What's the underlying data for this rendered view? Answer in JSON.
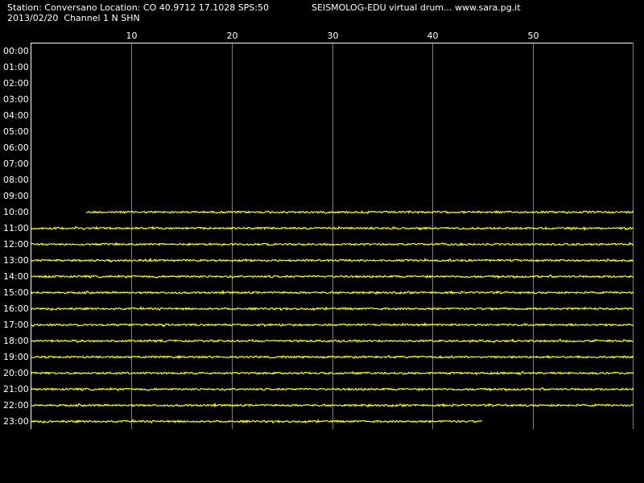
{
  "header": {
    "station_line": "Station: Conversano Location: CO 40.9712 17.1028 SPS:50",
    "title": "SEISMOLOG-EDU virtual drum... www.sara.pg.it",
    "date_line": "2013/02/20  Channel 1 N SHN"
  },
  "colors": {
    "background": "#000000",
    "trace": "#ffff00",
    "grid": "#808080",
    "axis": "#ffffff",
    "text": "#ffffff"
  },
  "chart_data": {
    "type": "line",
    "title": "",
    "xlabel": "",
    "ylabel": "",
    "x_unit": "minutes",
    "xlim": [
      0,
      60
    ],
    "x_ticks": [
      10,
      20,
      30,
      40,
      50
    ],
    "grid": true,
    "rows": [
      "00:00",
      "01:00",
      "02:00",
      "03:00",
      "04:00",
      "05:00",
      "06:00",
      "07:00",
      "08:00",
      "09:00",
      "10:00",
      "11:00",
      "12:00",
      "13:00",
      "14:00",
      "15:00",
      "16:00",
      "17:00",
      "18:00",
      "19:00",
      "20:00",
      "21:00",
      "22:00",
      "23:00"
    ],
    "traces": [
      {
        "row": "10:00",
        "start_min": 5.5,
        "end_min": 60
      },
      {
        "row": "11:00",
        "start_min": 0,
        "end_min": 60
      },
      {
        "row": "12:00",
        "start_min": 0,
        "end_min": 60
      },
      {
        "row": "13:00",
        "start_min": 0,
        "end_min": 60
      },
      {
        "row": "14:00",
        "start_min": 0,
        "end_min": 60
      },
      {
        "row": "15:00",
        "start_min": 0,
        "end_min": 60
      },
      {
        "row": "16:00",
        "start_min": 0,
        "end_min": 60
      },
      {
        "row": "17:00",
        "start_min": 0,
        "end_min": 60
      },
      {
        "row": "18:00",
        "start_min": 0,
        "end_min": 60
      },
      {
        "row": "19:00",
        "start_min": 0,
        "end_min": 60
      },
      {
        "row": "20:00",
        "start_min": 0,
        "end_min": 60
      },
      {
        "row": "21:00",
        "start_min": 0,
        "end_min": 60
      },
      {
        "row": "22:00",
        "start_min": 0,
        "end_min": 60
      },
      {
        "row": "23:00",
        "start_min": 0,
        "end_min": 45
      }
    ]
  }
}
